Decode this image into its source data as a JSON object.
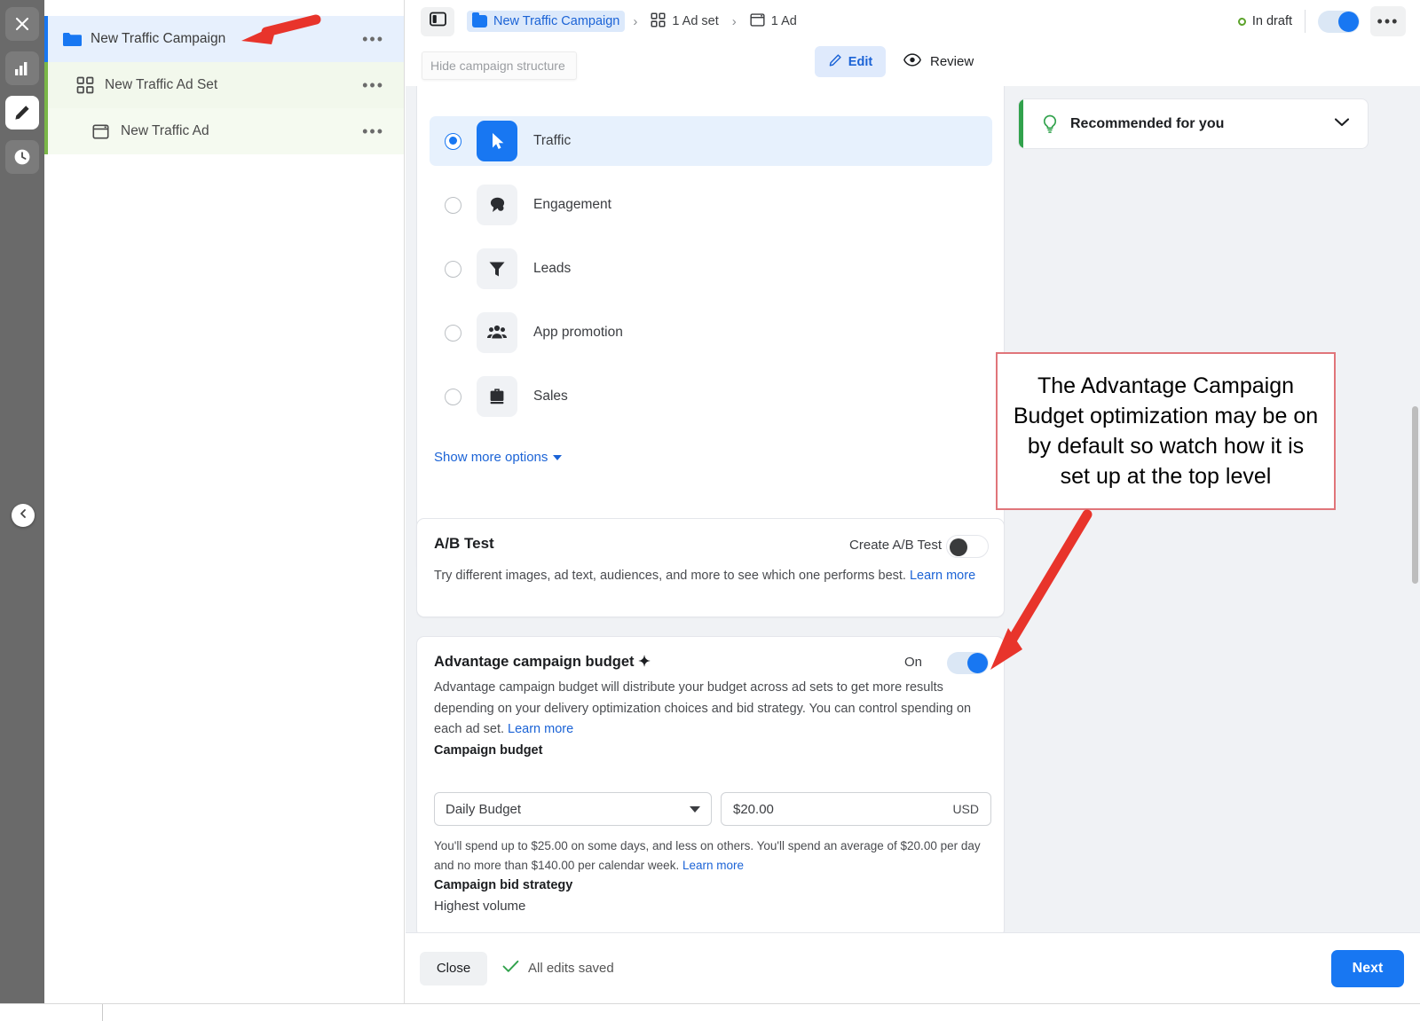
{
  "rail": {
    "items": [
      {
        "name": "close-icon",
        "label": "Close"
      },
      {
        "name": "chart-icon",
        "label": "Analytics"
      },
      {
        "name": "pencil-icon",
        "label": "Edit"
      },
      {
        "name": "clock-icon",
        "label": "History"
      }
    ],
    "collapse_label": "Collapse"
  },
  "structure": {
    "rows": [
      {
        "label": "New Traffic Campaign",
        "icon": "folder-icon",
        "menu": "•••"
      },
      {
        "label": "New Traffic Ad Set",
        "icon": "grid-icon",
        "menu": "•••"
      },
      {
        "label": "New Traffic Ad",
        "icon": "window-icon",
        "menu": "•••"
      }
    ]
  },
  "topbar": {
    "panel_toggle": "panel-toggle-icon",
    "breadcrumb": {
      "campaign": "New Traffic Campaign",
      "adset": "1 Ad set",
      "ad": "1 Ad",
      "separator": "›"
    },
    "status": "In draft",
    "more_menu": "•••"
  },
  "subbar": {
    "tooltip": "Hide campaign structure",
    "edit": "Edit",
    "review": "Review"
  },
  "objectives": {
    "items": [
      {
        "label": "Traffic",
        "selected": true,
        "icon": "cursor-icon"
      },
      {
        "label": "Engagement",
        "selected": false,
        "icon": "chat-bubble-icon"
      },
      {
        "label": "Leads",
        "selected": false,
        "icon": "funnel-icon"
      },
      {
        "label": "App promotion",
        "selected": false,
        "icon": "people-icon"
      },
      {
        "label": "Sales",
        "selected": false,
        "icon": "briefcase-icon"
      }
    ],
    "show_more": "Show more options"
  },
  "ab_test": {
    "title": "A/B Test",
    "toggle_label": "Create A/B Test",
    "toggle_state": "off",
    "description": "Try different images, ad text, audiences, and more to see which one performs best. ",
    "learn_more": "Learn more"
  },
  "advantage": {
    "title": "Advantage campaign budget ✦",
    "toggle_label": "On",
    "toggle_state": "on",
    "description": "Advantage campaign budget will distribute your budget across ad sets to get more results depending on your delivery optimization choices and bid strategy. You can control spending on each ad set. ",
    "learn_more": "Learn more",
    "budget_label": "Campaign budget",
    "budget_type": "Daily Budget",
    "budget_amount": "$20.00",
    "currency": "USD",
    "spend_note": "You'll spend up to $25.00 on some days, and less on others. You'll spend an average of $20.00 per day and no more than $140.00 per calendar week. ",
    "spend_note_link": "Learn more",
    "bid_label": "Campaign bid strategy",
    "bid_value": "Highest volume"
  },
  "recommended": {
    "title": "Recommended for you",
    "icon": "lightbulb-icon",
    "chevron": "chevron-down-icon"
  },
  "callout": {
    "text": "The Advantage Campaign Budget optimization may be on by default so watch how it is set up at the top level",
    "border_color": "#e0757a",
    "arrow_color": "#e8342b"
  },
  "bottombar": {
    "close": "Close",
    "saved": "All edits saved",
    "next": "Next"
  },
  "colors": {
    "accent_blue": "#1877f2",
    "green": "#31a24c",
    "rail_bg": "#6a6a6a",
    "page_bg": "#f0f2f5"
  }
}
